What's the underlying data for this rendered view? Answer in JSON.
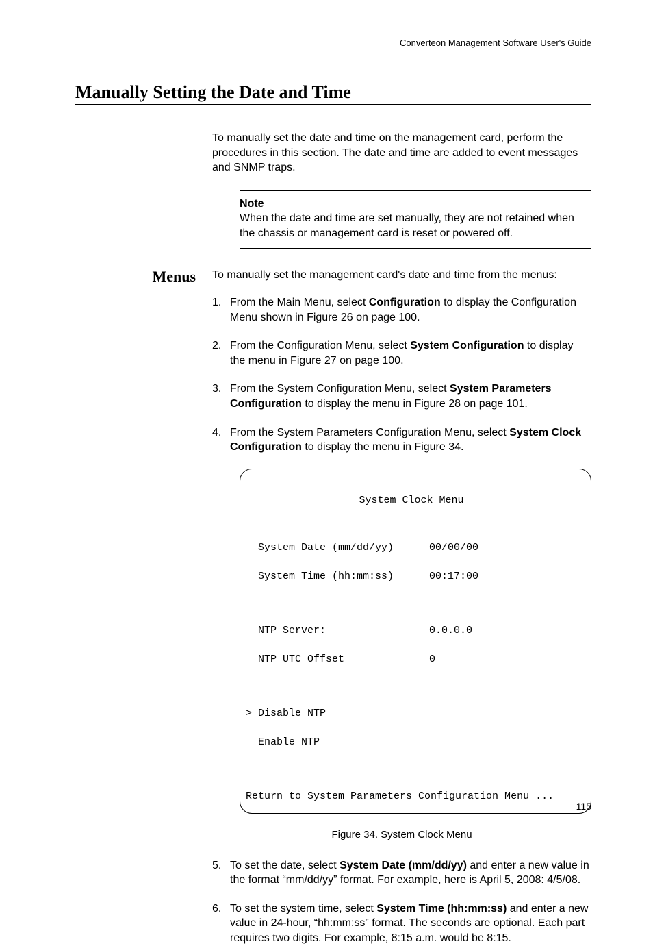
{
  "header": {
    "running_title": "Converteon Management Software User's Guide"
  },
  "title": "Manually Setting the Date and Time",
  "intro": "To manually set the date and time on the management card, perform the procedures in this section. The date and time are added to event messages and SNMP traps.",
  "note": {
    "label": "Note",
    "text": "When the date and time are set manually, they are not retained when the chassis or management card is reset or powered off."
  },
  "menus": {
    "heading": "Menus",
    "lead": "To manually set the management card's date and time from the menus:",
    "steps": {
      "s1": {
        "num": "1.",
        "pre": "From the Main Menu, select ",
        "b": "Configuration",
        "post": " to display the Configuration Menu shown in Figure 26 on page 100."
      },
      "s2": {
        "num": "2.",
        "pre": "From the Configuration Menu, select ",
        "b": "System Configuration",
        "post": " to display the menu in Figure 27 on page 100."
      },
      "s3": {
        "num": "3.",
        "pre": "From the System Configuration Menu, select ",
        "b": "System Parameters Configuration",
        "post": " to display the menu in Figure 28 on page 101."
      },
      "s4": {
        "num": "4.",
        "pre": "From the System Parameters Configuration Menu, select ",
        "b": "System Clock Configuration",
        "post": " to display the menu in Figure 34."
      },
      "s5": {
        "num": "5.",
        "pre": "To set the date, select ",
        "b": "System Date (mm/dd/yy)",
        "post": " and enter a new value in the format “mm/dd/yy” format. For example, here is April 5, 2008: 4/5/08."
      },
      "s6": {
        "num": "6.",
        "pre": "To set the system time, select ",
        "b": "System Time (hh:mm:ss)",
        "post": " and enter a new value in 24-hour, “hh:mm:ss” format. The seconds are optional. Each part requires two digits. For example, 8:15 a.m. would be 8:15."
      }
    }
  },
  "terminal": {
    "title": "System Clock Menu",
    "rows": {
      "date": {
        "label": "System Date (mm/dd/yy)",
        "value": "00/00/00"
      },
      "time": {
        "label": "System Time (hh:mm:ss)",
        "value": "00:17:00"
      },
      "ntp_server": {
        "label": "NTP Server:",
        "value": "0.0.0.0"
      },
      "ntp_offset": {
        "label": "NTP UTC Offset",
        "value": "0"
      },
      "disable": {
        "mark": ">",
        "label": "Disable NTP"
      },
      "enable": {
        "label": "Enable NTP"
      },
      "return": "Return to System Parameters Configuration Menu ..."
    }
  },
  "figure_caption": "Figure 34. System Clock Menu",
  "page_number": "115"
}
